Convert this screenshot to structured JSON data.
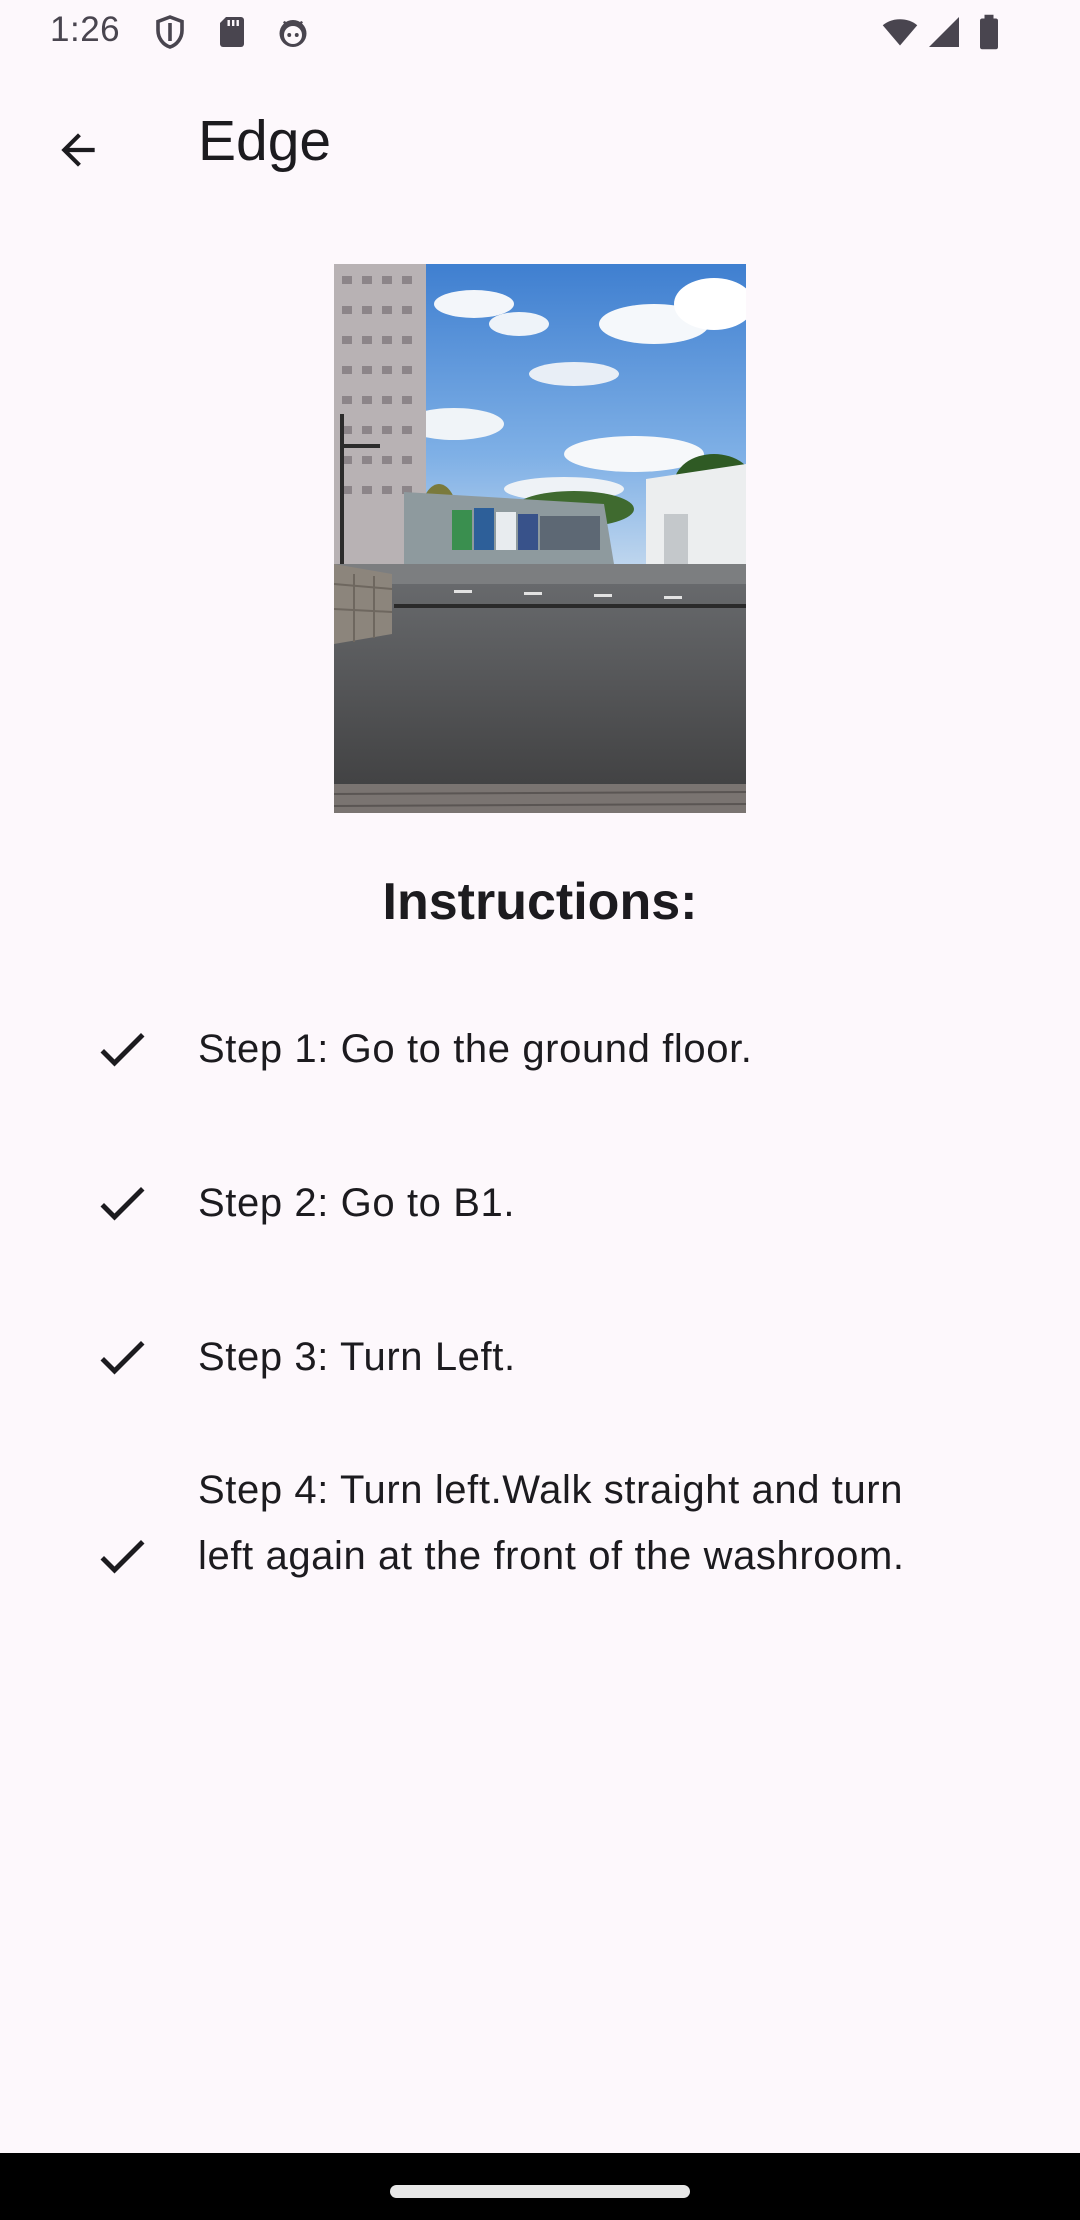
{
  "status_bar": {
    "time": "1:26",
    "icons": [
      "shield-icon",
      "sd-card-icon",
      "android-face-icon",
      "wifi-icon",
      "cellular-signal-icon",
      "battery-icon"
    ]
  },
  "app_bar": {
    "back_icon": "arrow-left-icon",
    "title": "Edge"
  },
  "photo": {
    "subject": "campus-road-buildings-photo"
  },
  "instructions": {
    "heading": "Instructions:",
    "check_icon": "check-icon",
    "steps": [
      "Step 1: Go to the ground floor.",
      "Step 2: Go to B1.",
      "Step 3: Turn Left.",
      "Step 4: Turn left.Walk straight and turn left again at the front of the washroom."
    ]
  },
  "colors": {
    "background": "#fdf8fc",
    "text": "#1c1b1f",
    "icon": "#49454f"
  }
}
